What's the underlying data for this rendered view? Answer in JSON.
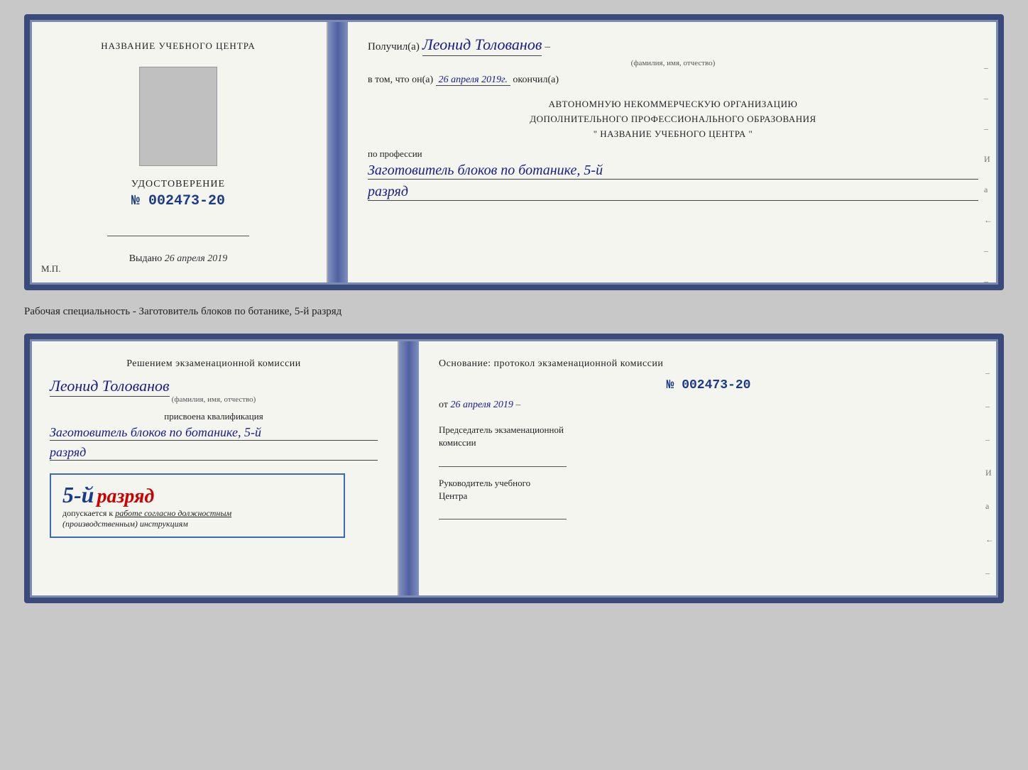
{
  "page": {
    "background_label": "Рабочая специальность - Заготовитель блоков по ботанике, 5-й разряд"
  },
  "cert_top": {
    "left": {
      "training_center_label": "НАЗВАНИЕ УЧЕБНОГО ЦЕНТРА",
      "document_label": "УДОСТОВЕРЕНИЕ",
      "number_prefix": "№",
      "number": "002473-20",
      "issued_label": "Выдано",
      "issued_date": "26 апреля 2019",
      "mp_label": "М.П."
    },
    "right": {
      "received_prefix": "Получил(а)",
      "recipient_name": "Леонид Толованов",
      "name_hint": "(фамилия, имя, отчество)",
      "date_prefix": "в том, что он(а)",
      "date_value": "26 апреля 2019г.",
      "finished_label": "окончил(а)",
      "org_line1": "АВТОНОМНУЮ НЕКОММЕРЧЕСКУЮ ОРГАНИЗАЦИЮ",
      "org_line2": "ДОПОЛНИТЕЛЬНОГО ПРОФЕССИОНАЛЬНОГО ОБРАЗОВАНИЯ",
      "org_line3": "\"   НАЗВАНИЕ УЧЕБНОГО ЦЕНТРА   \"",
      "profession_label": "по профессии",
      "profession_value": "Заготовитель блоков по ботанике, 5-й",
      "rank_value": "разряд",
      "dashes": [
        "-",
        "-",
        "-",
        "И",
        "а",
        "←",
        "-",
        "-",
        "-",
        "-"
      ]
    }
  },
  "cert_bottom": {
    "left": {
      "decision_text": "Решением экзаменационной комиссии",
      "person_name": "Леонид Толованов",
      "name_hint": "(фамилия, имя, отчество)",
      "qualification_label": "присвоена квалификация",
      "qualification_value": "Заготовитель блоков по ботанике, 5-й",
      "rank_value": "разряд",
      "badge_number": "5-й",
      "badge_text": "разряд",
      "допускается_prefix": "допускается к",
      "допускается_italic": "работе согласно должностным",
      "instructions_italic": "(производственным) инструкциям"
    },
    "right": {
      "basis_text": "Основание: протокол экзаменационной комиссии",
      "protocol_prefix": "№",
      "protocol_number": "002473-20",
      "from_prefix": "от",
      "from_date": "26 апреля 2019",
      "commission_chair_label": "Председатель экзаменационной",
      "commission_chair_label2": "комиссии",
      "training_center_head_label": "Руководитель учебного",
      "training_center_head_label2": "Центра",
      "dashes": [
        "-",
        "-",
        "-",
        "И",
        "а",
        "←",
        "-",
        "-",
        "-",
        "-"
      ]
    }
  }
}
